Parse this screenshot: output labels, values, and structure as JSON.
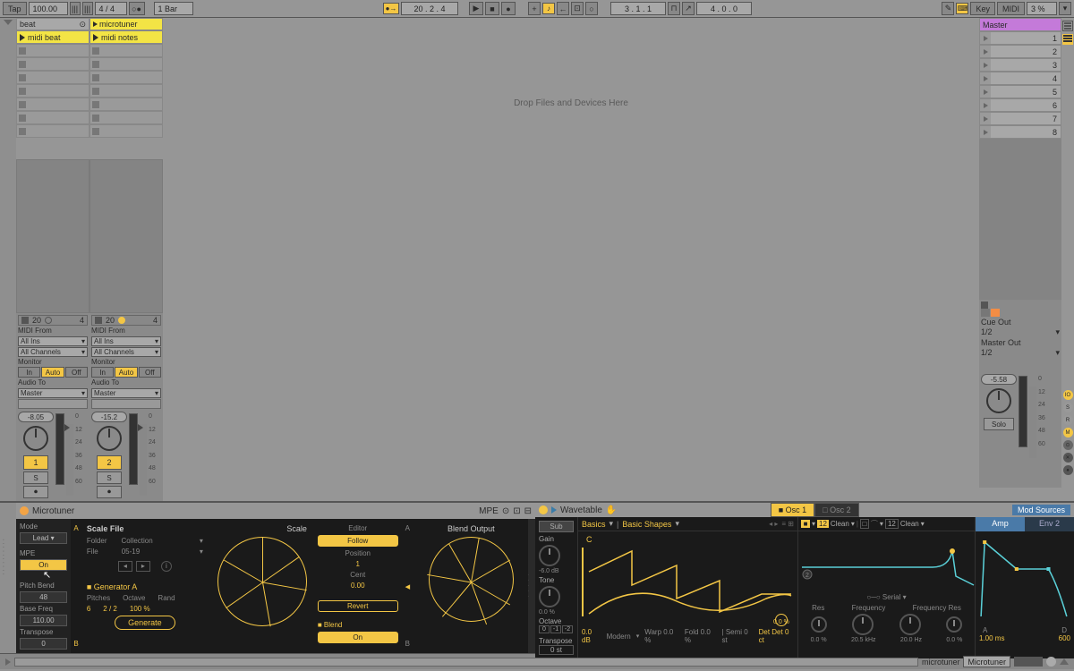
{
  "top": {
    "tap": "Tap",
    "bpm": "100.00",
    "sig": "4 / 4",
    "bar": "1 Bar",
    "pos1": "20 . 2 . 4",
    "pos2": "3 . 1 . 1",
    "pos3": "4 . 0 . 0",
    "key": "Key",
    "midi": "MIDI",
    "pct": "3 %"
  },
  "tracks": [
    {
      "name": "beat",
      "clip": "midi beat"
    },
    {
      "name": "microtuner",
      "clip": "midi notes"
    }
  ],
  "mixer": {
    "num1": "20",
    "br1": "4",
    "label_from": "MIDI From",
    "all_ins": "All Ins",
    "all_ch": "All Channels",
    "monitor": "Monitor",
    "mon_in": "In",
    "mon_auto": "Auto",
    "mon_off": "Off",
    "audio_to": "Audio To",
    "master": "Master",
    "db1": "-8.05",
    "db2": "-15.2",
    "scale": [
      "0",
      "12",
      "24",
      "36",
      "48",
      "60"
    ],
    "btn1": "1",
    "btn2": "2",
    "s": "S"
  },
  "drop": "Drop Files and Devices Here",
  "master": {
    "title": "Master",
    "scenes": [
      "1",
      "2",
      "3",
      "4",
      "5",
      "6",
      "7",
      "8"
    ],
    "cue_out": "Cue Out",
    "io": "1/2",
    "master_out": "Master Out",
    "db": "-5.58",
    "solo": "Solo"
  },
  "micro": {
    "title": "Microtuner",
    "mpe_t": "MPE",
    "mode_l": "Mode",
    "mode_v": "Lead",
    "mpe_l": "MPE",
    "mpe_v": "On",
    "pb_l": "Pitch Bend",
    "pb_v": "48",
    "bf_l": "Base Freq",
    "bf_v": "110.00",
    "tr_l": "Transpose",
    "tr_v": "0",
    "scale_file": "Scale File",
    "scale": "Scale",
    "folder": "Folder",
    "collection": "Collection",
    "file": "File",
    "file_v": "05-19",
    "gen": "Generator A",
    "pitches_l": "Pitches",
    "pitches_v": "6",
    "oct_l": "Octave",
    "oct_v": "2 / 2",
    "rand_l": "Rand",
    "rand_v": "100 %",
    "generate": "Generate",
    "editor": "Editor",
    "follow": "Follow",
    "position_l": "Position",
    "position_v": "1",
    "cent_l": "Cent",
    "cent_v": "0.00",
    "revert": "Revert",
    "blend_out": "Blend Output",
    "blend": "Blend",
    "on": "On",
    "a": "A",
    "b": "B"
  },
  "wave": {
    "title": "Wavetable",
    "osc1": "Osc 1",
    "osc2": "Osc 2",
    "sub": "Sub",
    "gain": "Gain",
    "gain_v": "-6.0 dB",
    "tone": "Tone",
    "tone_v": "0.0 %",
    "octave": "Octave",
    "oct_b": [
      "0",
      "-1",
      "-2"
    ],
    "trans": "Transpose",
    "trans_v": "0 st",
    "basics": "Basics",
    "shapes": "Basic Shapes",
    "bottom_db": "0.0 dB",
    "modern": "Modern",
    "warp": "Warp 0.0 %",
    "fold": "Fold 0.0 %",
    "semi": "Semi 0 st",
    "det": "Det 0 ct",
    "det_v": "0.0 %",
    "clean": "Clean",
    "serial": "Serial",
    "num": "12",
    "res": "Res",
    "freq": "Frequency",
    "fres": "Frequency Res",
    "res_v": "0.0 %",
    "f1": "20.5 kHz",
    "f2": "20.0 Hz",
    "fres_v": "0.0 %",
    "mod": "Mod Sources",
    "amp": "Amp",
    "env2": "Env 2",
    "a": "A",
    "d": "D",
    "ms": "1.00 ms",
    "ms2": "600"
  },
  "status": {
    "dev": "microtuner",
    "name": "Microtuner"
  }
}
